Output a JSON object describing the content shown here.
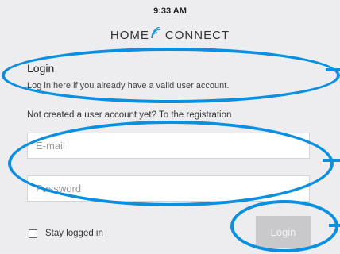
{
  "status": {
    "time": "9:33 AM"
  },
  "logo": {
    "left": "home",
    "right": "connect"
  },
  "login": {
    "title": "Login",
    "description": "Log in here if you already have a valid user account.",
    "register_text": "Not created a user account yet? To the registration",
    "email_placeholder": "E-mail",
    "password_placeholder": "Password",
    "stay_logged_in": "Stay logged in",
    "button_label": "Login"
  },
  "colors": {
    "annotation": "#0b8fe0",
    "background": "#ededf0",
    "button_disabled": "#c9c9cc"
  }
}
